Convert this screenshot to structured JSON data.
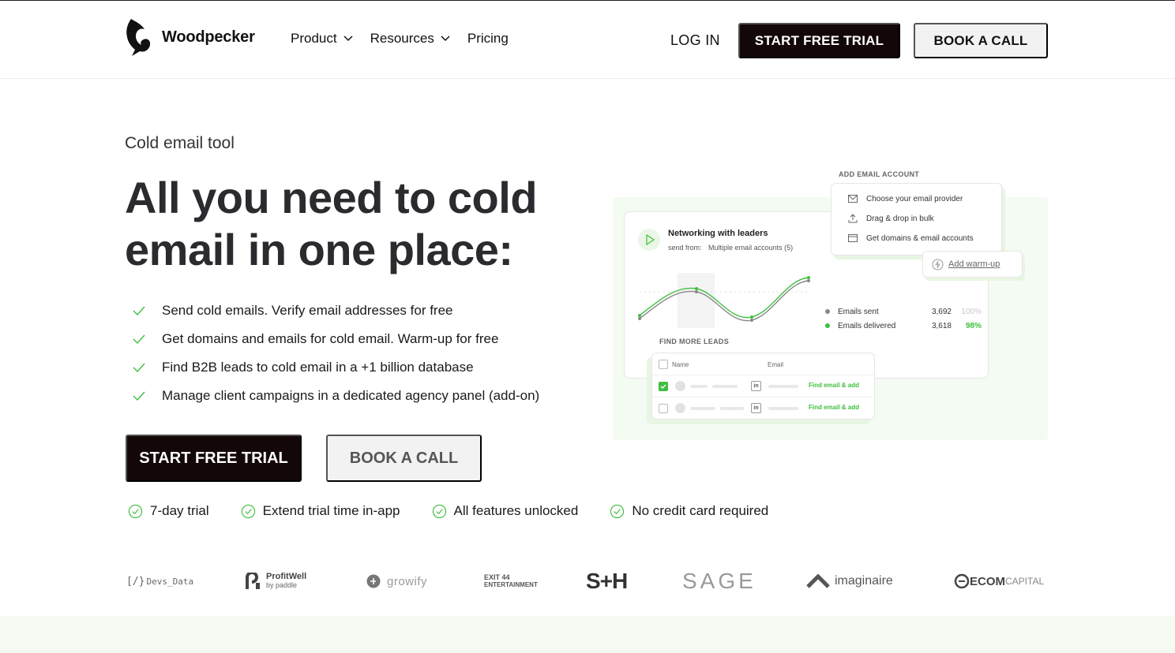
{
  "nav": {
    "brand": "Woodpecker",
    "menu": [
      {
        "label": "Product",
        "has_dropdown": true
      },
      {
        "label": "Resources",
        "has_dropdown": true
      },
      {
        "label": "Pricing",
        "has_dropdown": false
      }
    ],
    "login": "LOG IN",
    "trial": "START FREE TRIAL",
    "book": "BOOK A CALL"
  },
  "hero": {
    "eyebrow": "Cold email tool",
    "headline": "All you need to cold email in one place:",
    "features": [
      "Send cold emails. Verify email addresses for free",
      "Get domains and emails for cold email. Warm-up for free",
      "Find B2B leads to cold email in a +1 billion database",
      "Manage client campaigns in a dedicated agency panel (add-on)"
    ],
    "cta_primary": "START FREE TRIAL",
    "cta_secondary": "BOOK A CALL",
    "perks": [
      "7-day trial",
      "Extend trial time in-app",
      "All features unlocked",
      "No credit card required"
    ]
  },
  "illustration": {
    "campaign_title": "Networking with leaders",
    "campaign_sub_label": "send from:",
    "campaign_sub_value": "Multiple email accounts (5)",
    "stats": [
      {
        "label": "Emails sent",
        "value": "3,692",
        "pct": "100%",
        "color": "#888888"
      },
      {
        "label": "Emails delivered",
        "value": "3,618",
        "pct": "98%",
        "color": "#3fbf3f"
      }
    ],
    "add_account": {
      "heading": "ADD EMAIL ACCOUNT",
      "items": [
        "Choose your email provider",
        "Drag & drop in bulk",
        "Get domains & email accounts"
      ]
    },
    "warmup": "Add warm-up",
    "leads": {
      "heading": "FIND MORE LEADS",
      "col_name": "Name",
      "col_email": "Email",
      "linkedin": "in",
      "action": "Find email & add"
    }
  },
  "logos": [
    "Devs_Data",
    "ProfitWell",
    "by paddle",
    "growify",
    "EXIT 44",
    "ENTERTAINMENT",
    "S+H",
    "SAGE",
    "imaginaire",
    "ECOM",
    "CAPITAL"
  ],
  "colors": {
    "dark": "#140708",
    "accent_green": "#3fbf3f",
    "light_button": "#f2f2f2",
    "band": "#f5fbf3"
  }
}
